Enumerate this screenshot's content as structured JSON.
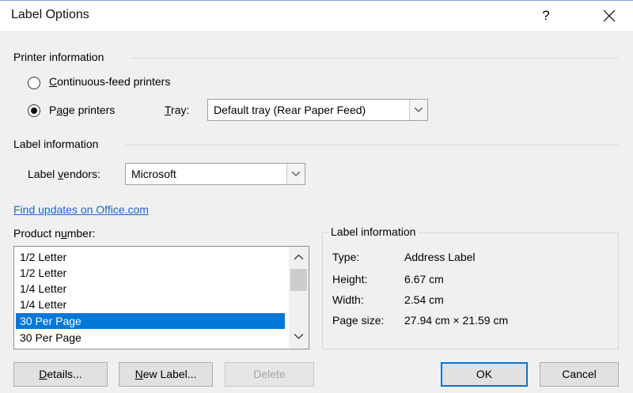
{
  "dialog": {
    "title": "Label Options",
    "help_label": "?",
    "printer_info": {
      "heading": "Printer information",
      "continuous_label_pre": "",
      "continuous_label_key": "C",
      "continuous_label_post": "ontinuous-feed printers",
      "page_label_pre": "P",
      "page_label_key": "a",
      "page_label_post": "ge printers",
      "tray_label_key": "T",
      "tray_label_post": "ray:",
      "tray_value": "Default tray (Rear Paper Feed)",
      "selected": "page"
    },
    "label_info": {
      "heading": "Label information",
      "vendors_label_pre": "Label ",
      "vendors_label_key": "v",
      "vendors_label_post": "endors:",
      "vendor_value": "Microsoft"
    },
    "link": "Find updates on Office.com",
    "product": {
      "label_pre": "Product n",
      "label_key": "u",
      "label_post": "mber:",
      "items": [
        "1/2 Letter",
        "1/2 Letter",
        "1/4 Letter",
        "1/4 Letter",
        "30 Per Page",
        "30 Per Page"
      ],
      "selected_index": 4
    },
    "details": {
      "heading": "Label information",
      "type_key": "Type:",
      "type_val": "Address Label",
      "height_key": "Height:",
      "height_val": "6.67 cm",
      "width_key": "Width:",
      "width_val": "2.54 cm",
      "pagesize_key": "Page size:",
      "pagesize_val": "27.94 cm × 21.59 cm"
    },
    "buttons": {
      "details_key": "D",
      "details_post": "etails...",
      "new_key": "N",
      "new_post": "ew Label...",
      "delete": "Delete",
      "ok": "OK",
      "cancel": "Cancel"
    },
    "colors": {
      "accent": "#0078d7",
      "link": "#1a66cc",
      "selection": "#0078d7"
    }
  }
}
